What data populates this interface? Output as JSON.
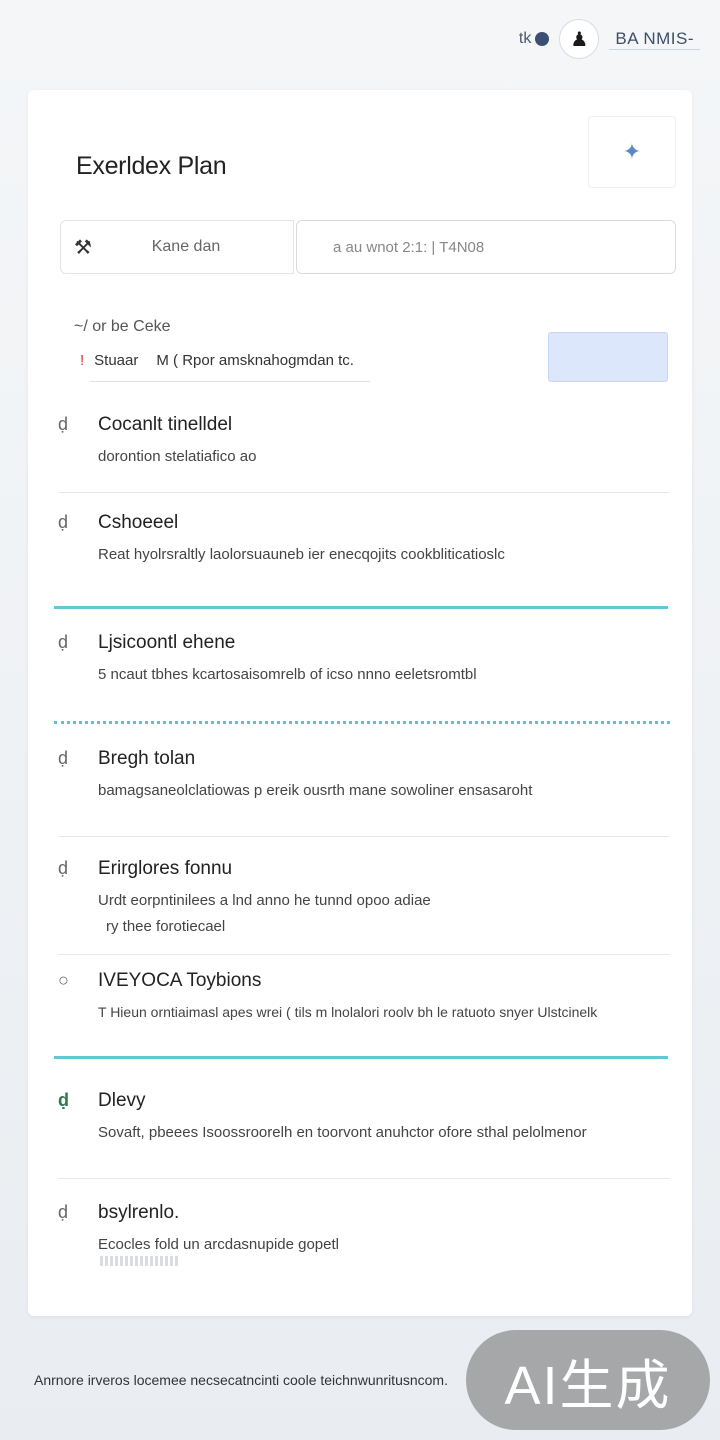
{
  "header": {
    "status_text": "tk",
    "user_name": "BA NMIS-"
  },
  "card": {
    "title": "Exerldex Plan",
    "search": {
      "button_label": "Kane dan",
      "input_text": "a au wnot 2:1:   | T4N08"
    },
    "filter": {
      "label": "~/ or be Ceke",
      "key": "Stuaar",
      "value": "M ( Rpor amsknahogmdan tc."
    },
    "items": [
      {
        "icon": "droplet-icon",
        "title": "Cocanlt tinelldel",
        "desc": "dorontion stelatiafico ao",
        "desc2": ""
      },
      {
        "icon": "droplet-icon",
        "title": "Cshoeeel",
        "desc": "Reat hyolrsraltly laolorsuauneb ier enecqojits cookbliticatioslc",
        "desc2": ""
      },
      {
        "icon": "droplet-icon",
        "title": "Ljsicoontl ehene",
        "desc": "5 ncaut tbhes kcartosaisomrelb of icso nnno eeletsromtbl",
        "desc2": ""
      },
      {
        "icon": "droplet-icon",
        "title": "Bregh tolan",
        "desc": "bamagsaneolclatiowas p ereik ousrth mane sowoliner ensasaroht",
        "desc2": ""
      },
      {
        "icon": "droplet-icon",
        "title": "Erirglores fonnu",
        "desc": "Urdt eorpntinilees a lnd anno he tunnd opoo adiae",
        "desc2": "ry thee forotiecael"
      },
      {
        "icon": "droplet-icon",
        "title": "IVEYOCA Toybions",
        "desc": "T Hieun orntiaimasl apes wrei ( tils m lnolalori roolv bh le ratuoto snyer Ulstcinelk",
        "desc2": ""
      },
      {
        "icon": "droplet-icon",
        "title": "Dlevy",
        "desc": "Sovaft, pbeees Isoossroorelh en toorvont anuhctor ofore sthal pelolmenor",
        "desc2": ""
      },
      {
        "icon": "droplet-icon",
        "title": "bsylrenlo.",
        "desc": "Ecocles fold un arcdasnupide gopetl",
        "desc2": ""
      }
    ]
  },
  "footer": {
    "note": "Anrnore irveros locemee necsecatncinti coole teichnwunritusncom.",
    "badge": "AI生成"
  }
}
